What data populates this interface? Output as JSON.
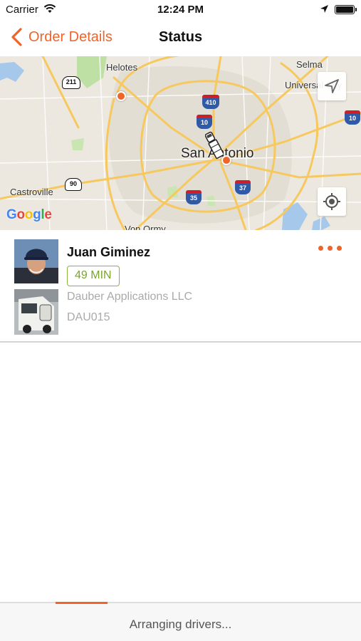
{
  "status_bar": {
    "carrier": "Carrier",
    "time": "12:24 PM"
  },
  "nav": {
    "back_label": "Order Details",
    "title": "Status"
  },
  "map": {
    "city": "San Antonio",
    "labels": {
      "helotes": "Helotes",
      "selma": "Selma",
      "universal_city": "Universal City",
      "castroville": "Castroville",
      "von_ormy": "Von Ormy"
    },
    "highways": {
      "i410": "410",
      "i10_north": "10",
      "i10_east": "10",
      "i35": "35",
      "i37": "37",
      "us90": "90",
      "sr211": "211"
    },
    "attribution": "Google"
  },
  "driver": {
    "name": "Juan Giminez",
    "eta": "49 MIN",
    "company": "Dauber Applications LLC",
    "truck_id": "DAU015"
  },
  "footer": {
    "status": "Arranging drivers..."
  },
  "colors": {
    "accent": "#f06429",
    "eta_green": "#7aa52c",
    "map_background": "#ece8df",
    "road_major": "#f6c85e"
  }
}
